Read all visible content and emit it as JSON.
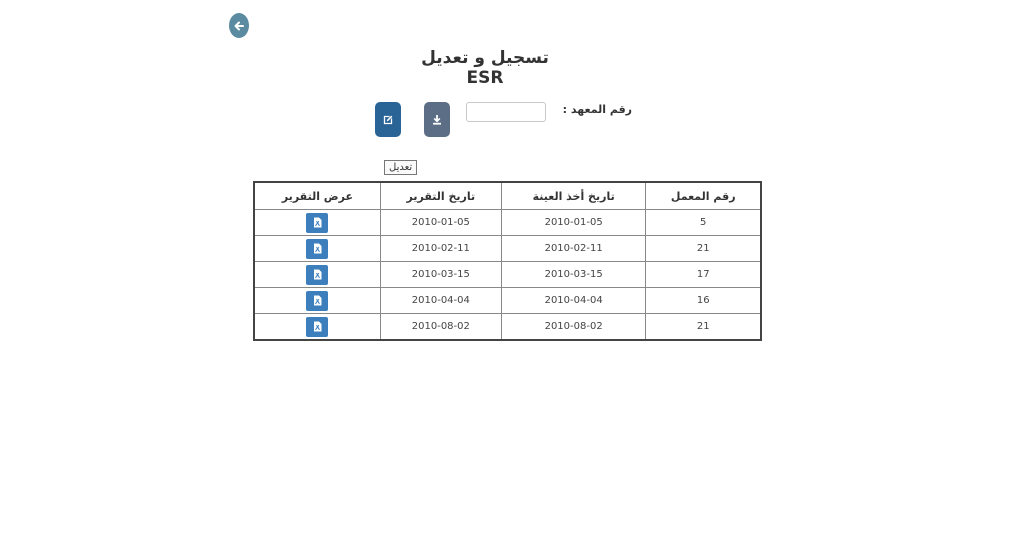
{
  "header": {
    "title": "تسجيل و تعديل ESR"
  },
  "form": {
    "institute_label": "رقم المعهد :",
    "institute_value": "",
    "institute_placeholder": "",
    "edit_tooltip": "تعديل"
  },
  "icons": {
    "back": "arrow-left-icon",
    "download": "download-icon",
    "edit": "edit-icon",
    "report": "pdf-file-icon"
  },
  "colors": {
    "back_button": "#5a8ba0",
    "download_button": "#5b6e85",
    "edit_button": "#2a6396",
    "view_button": "#3d7ebd"
  },
  "table": {
    "columns": [
      "رقم المعمل",
      "تاريخ أخذ العينة",
      "تاريخ التقرير",
      "عرض التقرير"
    ],
    "rows": [
      {
        "lab": "5",
        "sample_date": "2010-01-05",
        "report_date": "2010-01-05"
      },
      {
        "lab": "21",
        "sample_date": "2010-02-11",
        "report_date": "2010-02-11"
      },
      {
        "lab": "17",
        "sample_date": "2010-03-15",
        "report_date": "2010-03-15"
      },
      {
        "lab": "16",
        "sample_date": "2010-04-04",
        "report_date": "2010-04-04"
      },
      {
        "lab": "21",
        "sample_date": "2010-08-02",
        "report_date": "2010-08-02"
      }
    ]
  }
}
